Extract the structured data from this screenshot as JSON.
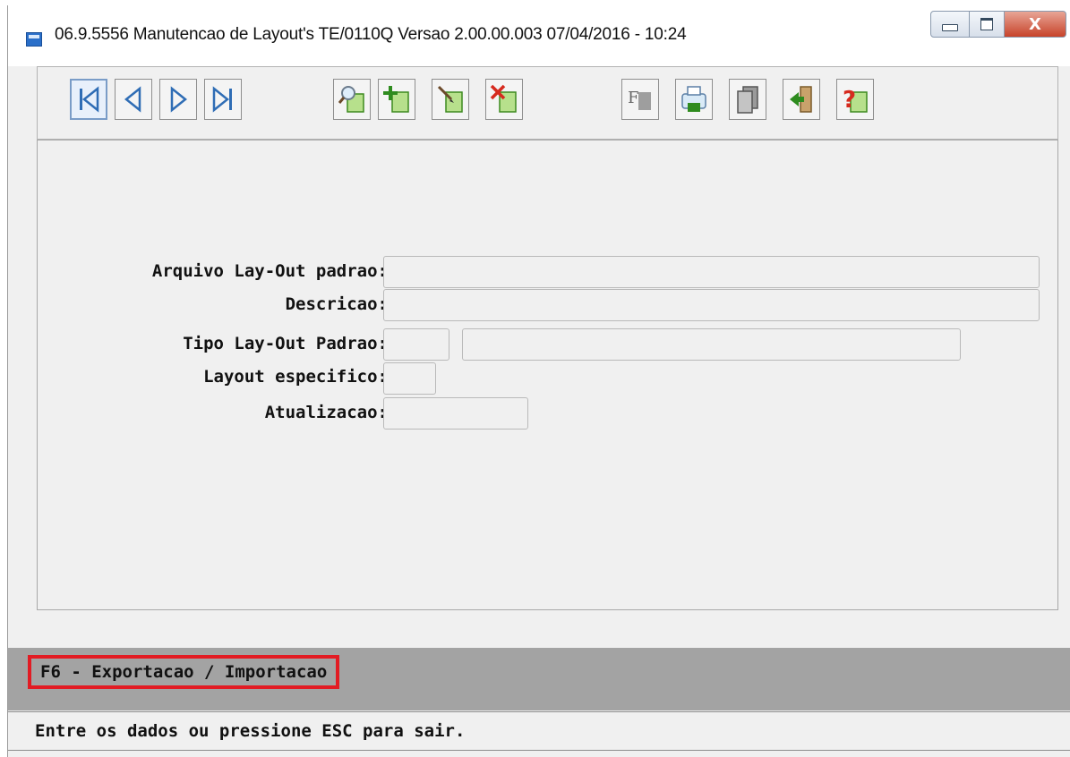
{
  "window": {
    "title": "06.9.5556 Manutencao  de Layout's TE/0110Q Versao 2.00.00.003 07/04/2016 - 10:24",
    "close_glyph": "X"
  },
  "toolbar": {
    "buttons": [
      {
        "name": "first-record-button",
        "icon": "first-icon"
      },
      {
        "name": "previous-record-button",
        "icon": "previous-icon"
      },
      {
        "name": "next-record-button",
        "icon": "next-icon"
      },
      {
        "name": "last-record-button",
        "icon": "last-icon"
      },
      {
        "name": "search-button",
        "icon": "search-icon"
      },
      {
        "name": "add-button",
        "icon": "add-icon"
      },
      {
        "name": "edit-button",
        "icon": "edit-icon"
      },
      {
        "name": "delete-button",
        "icon": "delete-icon"
      },
      {
        "name": "filter-button",
        "icon": "filter-icon"
      },
      {
        "name": "print-button",
        "icon": "print-icon"
      },
      {
        "name": "copy-button",
        "icon": "copy-icon"
      },
      {
        "name": "exit-button",
        "icon": "exit-icon"
      },
      {
        "name": "help-button",
        "icon": "help-icon"
      }
    ],
    "filter_glyph": "F",
    "help_glyph": "?"
  },
  "form": {
    "arquivo_label": "Arquivo Lay-Out padrao:",
    "arquivo_value": "",
    "descricao_label": "Descricao:",
    "descricao_value": "",
    "tipo_label": "Tipo Lay-Out Padrao:",
    "tipo_code_value": "",
    "tipo_desc_value": "",
    "layout_esp_label": "Layout especifico:",
    "layout_esp_value": "",
    "atualizacao_label": "Atualizacao:",
    "atualizacao_value": ""
  },
  "fkey": {
    "f6_label": "F6 - Exportacao / Importacao"
  },
  "status": {
    "message": "Entre os dados ou pressione ESC para sair."
  },
  "colors": {
    "highlight_border": "#e21b23",
    "fkey_bar": "#a3a3a3",
    "icon_green": "#5cb03a",
    "icon_red": "#d62a1e"
  }
}
